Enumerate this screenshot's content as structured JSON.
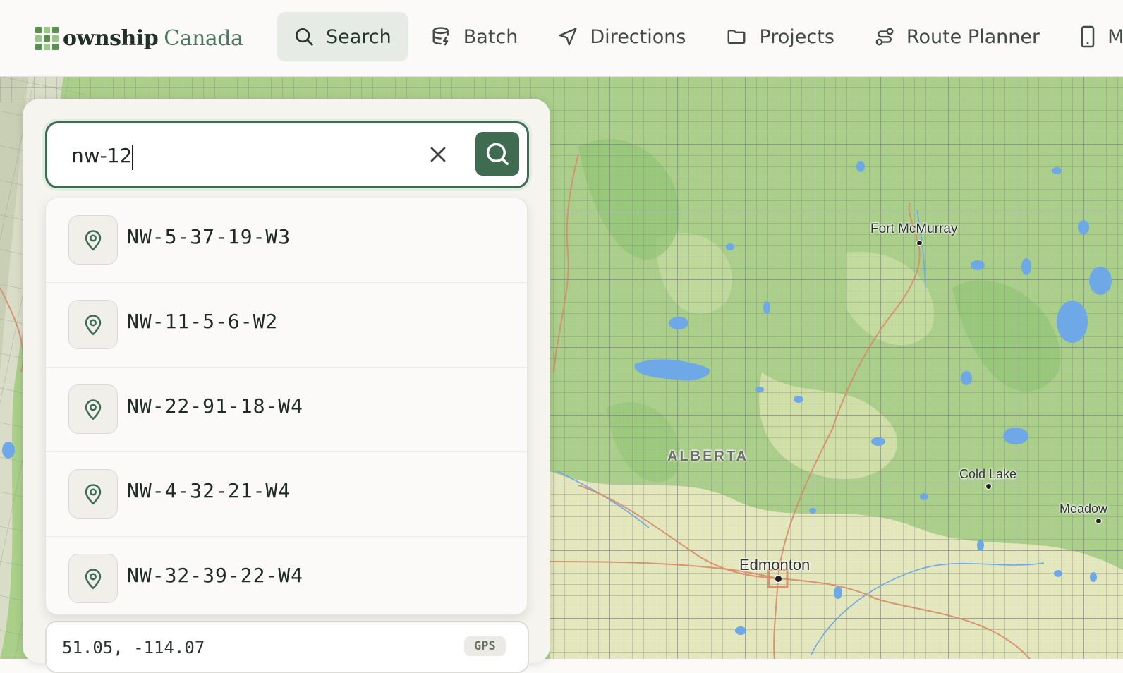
{
  "brand": {
    "name_bold": "ownship",
    "name_light": "Canada"
  },
  "nav": {
    "items": [
      {
        "label": "Search",
        "icon": "search-icon",
        "active": true
      },
      {
        "label": "Batch",
        "icon": "database-icon",
        "active": false
      },
      {
        "label": "Directions",
        "icon": "navigation-arrow-icon",
        "active": false
      },
      {
        "label": "Projects",
        "icon": "folder-icon",
        "active": false
      },
      {
        "label": "Route Planner",
        "icon": "route-icon",
        "active": false
      },
      {
        "label": "M",
        "icon": "mobile-icon",
        "active": false
      }
    ]
  },
  "search": {
    "value": "nw-12",
    "results": [
      {
        "label": "NW-5-37-19-W3"
      },
      {
        "label": "NW-11-5-6-W2"
      },
      {
        "label": "NW-22-91-18-W4"
      },
      {
        "label": "NW-4-32-21-W4"
      },
      {
        "label": "NW-32-39-22-W4"
      }
    ]
  },
  "coordinates": {
    "text": "51.05, -114.07",
    "badge": "GPS"
  },
  "map": {
    "labels": {
      "fort_mcmurray": "Fort McMurray",
      "alberta": "ALBERTA",
      "cold_lake": "Cold Lake",
      "meadow": "Meadow",
      "edmonton": "Edmonton"
    }
  },
  "colors": {
    "accent": "#3f6b50",
    "map_green": "#a8cf86",
    "map_light": "#e6e8be",
    "water": "#6fa9e6"
  }
}
